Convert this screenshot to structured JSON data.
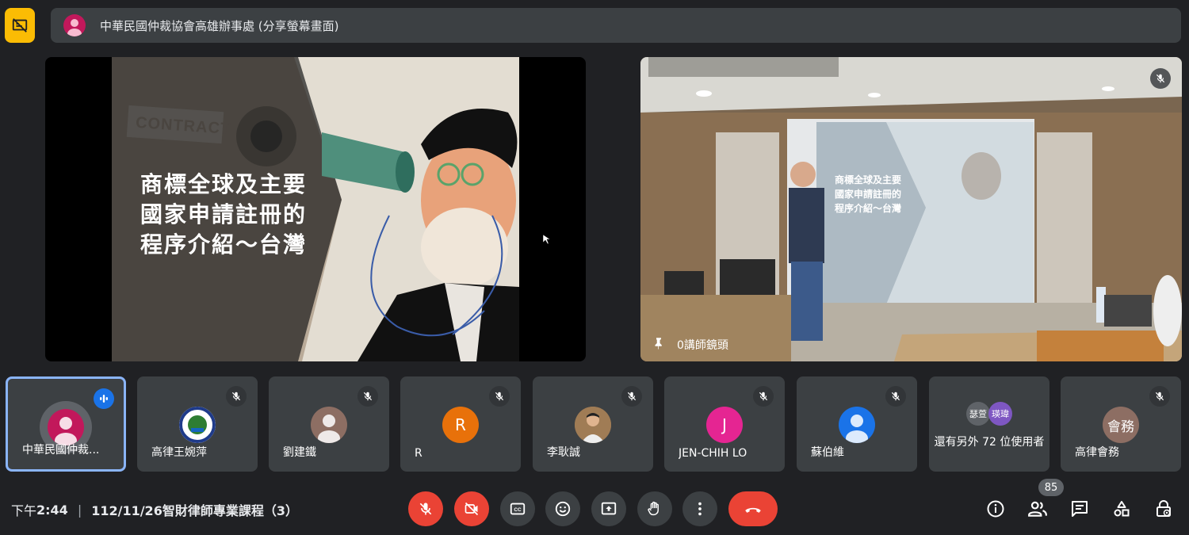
{
  "presenter_bar": {
    "title": "中華民國仲裁協會高雄辦事處 (分享螢幕畫面)"
  },
  "shared_slide": {
    "lines": [
      "商標全球及主要",
      "國家申請註冊的",
      "程序介紹～台灣"
    ],
    "art_label": "CONTRACT"
  },
  "camera_tile": {
    "name": "0講師鏡頭",
    "screen_lines": [
      "商標全球及主要",
      "國家申請註冊的",
      "程序介紹～台灣"
    ]
  },
  "participants": [
    {
      "name": "中華民國仲裁...",
      "avatar_kind": "person",
      "avatar_color": "#c2185b",
      "state": "speaking"
    },
    {
      "name": "高律王婉萍",
      "avatar_kind": "logo",
      "avatar_color": "#ffffff",
      "state": "muted"
    },
    {
      "name": "劉建鐵",
      "avatar_kind": "person",
      "avatar_color": "#8d6e63",
      "state": "muted"
    },
    {
      "name": "R",
      "avatar_kind": "letter",
      "avatar_letter": "R",
      "avatar_color": "#e8710a",
      "state": "muted"
    },
    {
      "name": "李耿誠",
      "avatar_kind": "photo",
      "avatar_color": "#8a6a4a",
      "state": "muted"
    },
    {
      "name": "JEN-CHIH LO",
      "avatar_kind": "letter",
      "avatar_letter": "J",
      "avatar_color": "#e52592",
      "state": "muted"
    },
    {
      "name": "蘇伯維",
      "avatar_kind": "person",
      "avatar_color": "#1a73e8",
      "state": "muted"
    },
    {
      "name": "還有另外 72 位使用者",
      "avatar_kind": "group",
      "group_labels": [
        "瑟萱",
        "瑛瑋"
      ],
      "group_colors": [
        "#5f6368",
        "#7e57c2"
      ],
      "state": "none"
    },
    {
      "name": "高律會務",
      "avatar_kind": "text",
      "avatar_text": "會務",
      "avatar_color": "#8d6e63",
      "state": "muted"
    }
  ],
  "meeting": {
    "time_prefix": "下午",
    "time": "2:44",
    "separator": "|",
    "title": "112/11/26智財律師專業課程（3）"
  },
  "controls": [
    {
      "name": "mic-off",
      "color": "#ea4335"
    },
    {
      "name": "camera-off",
      "color": "#ea4335"
    },
    {
      "name": "captions",
      "color": "#3c4043"
    },
    {
      "name": "emoji",
      "color": "#3c4043"
    },
    {
      "name": "present",
      "color": "#3c4043"
    },
    {
      "name": "raise-hand",
      "color": "#3c4043"
    },
    {
      "name": "more",
      "color": "#3c4043"
    },
    {
      "name": "hang-up",
      "color": "#ea4335"
    }
  ],
  "side_controls": {
    "participant_count": "85",
    "icons": [
      "info-icon",
      "people-icon",
      "chat-icon",
      "activities-icon",
      "host-controls-icon"
    ]
  }
}
